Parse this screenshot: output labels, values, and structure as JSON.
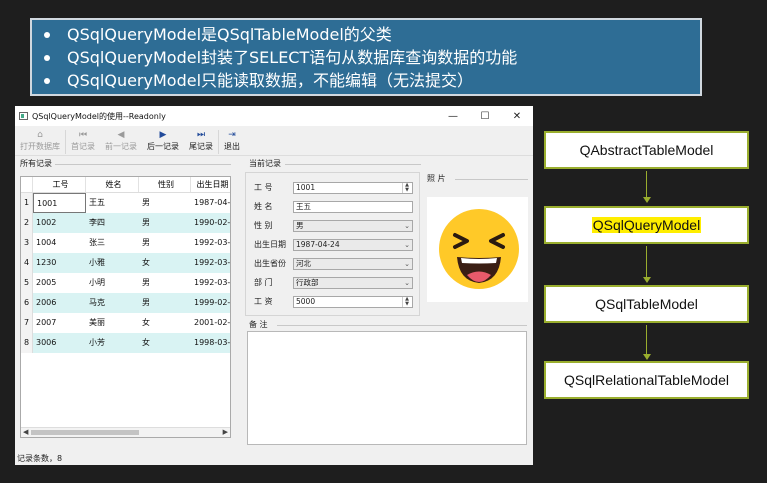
{
  "slide": {
    "bullets": [
      "QSqlQueryModel是QSqlTableModel的父类",
      "QSqlQueryModel封装了SELECT语句从数据库查询数据的功能",
      "QSqlQueryModel只能读取数据，不能编辑（无法提交）"
    ]
  },
  "window": {
    "title": "QSqlQueryModel的使用--Readonly",
    "controls": {
      "minimize": "—",
      "maximize": "☐",
      "close": "✕"
    },
    "toolbar": [
      {
        "label": "打开数据库",
        "icon": "open-db-icon",
        "glyph": "⌂",
        "enabled": false
      },
      {
        "label": "首记录",
        "icon": "first-record-icon",
        "glyph": "⏮",
        "enabled": false
      },
      {
        "label": "前一记录",
        "icon": "prev-record-icon",
        "glyph": "◀",
        "enabled": false
      },
      {
        "label": "后一记录",
        "icon": "next-record-icon",
        "glyph": "▶",
        "enabled": true
      },
      {
        "label": "尾记录",
        "icon": "last-record-icon",
        "glyph": "⏭",
        "enabled": true
      },
      {
        "label": "退出",
        "icon": "exit-icon",
        "glyph": "⇥",
        "enabled": true
      }
    ],
    "records_group_label": "所有记录",
    "current_group_label": "当前记录",
    "photo_label": "照 片",
    "notes_label": "备 注",
    "status": "记录条数，8",
    "table": {
      "columns": [
        "工号",
        "姓名",
        "性别",
        "出生日期"
      ],
      "rows": [
        {
          "n": "1",
          "id": "1001",
          "name": "王五",
          "sex": "男",
          "birth": "1987-04-"
        },
        {
          "n": "2",
          "id": "1002",
          "name": "李四",
          "sex": "男",
          "birth": "1990-02-"
        },
        {
          "n": "3",
          "id": "1004",
          "name": "张三",
          "sex": "男",
          "birth": "1992-03-"
        },
        {
          "n": "4",
          "id": "1230",
          "name": "小雅",
          "sex": "女",
          "birth": "1992-03-"
        },
        {
          "n": "5",
          "id": "2005",
          "name": "小明",
          "sex": "男",
          "birth": "1992-03-"
        },
        {
          "n": "6",
          "id": "2006",
          "name": "马克",
          "sex": "男",
          "birth": "1999-02-"
        },
        {
          "n": "7",
          "id": "2007",
          "name": "美丽",
          "sex": "女",
          "birth": "2001-02-"
        },
        {
          "n": "8",
          "id": "3006",
          "name": "小芳",
          "sex": "女",
          "birth": "1998-03-"
        }
      ]
    },
    "form": {
      "id_label": "工 号",
      "id_value": "1001",
      "name_label": "姓 名",
      "name_value": "王五",
      "sex_label": "性 别",
      "sex_value": "男",
      "birth_label": "出生日期",
      "birth_value": "1987-04-24",
      "province_label": "出生省份",
      "province_value": "河北",
      "dept_label": "部 门",
      "dept_value": "行政部",
      "salary_label": "工 资",
      "salary_value": "5000"
    }
  },
  "hierarchy": {
    "classes": [
      "QAbstractTableModel",
      "QSqlQueryModel",
      "QSqlTableModel",
      "QSqlRelationalTableModel"
    ],
    "highlight_color": "#ffee00",
    "border_color": "#9aae2e"
  }
}
